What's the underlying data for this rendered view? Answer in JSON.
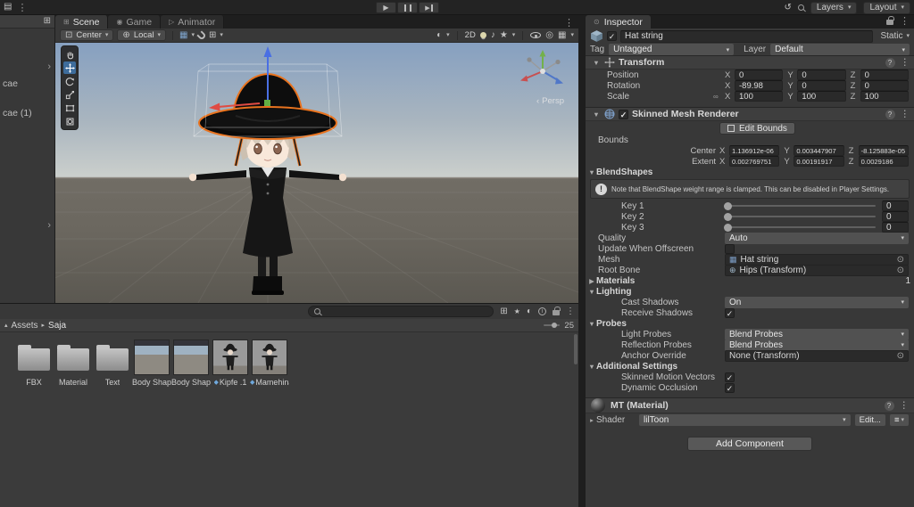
{
  "colors": {
    "selection_orange": "#E8731F",
    "unity_selected_blue": "#3E6D9C"
  },
  "topbar": {
    "tabs": [
      {
        "label": "Scene"
      },
      {
        "label": "Game"
      },
      {
        "label": "Animator"
      }
    ],
    "layers_label": "Layers",
    "layout_label": "Layout"
  },
  "hierarchy": {
    "items": [
      "cae",
      "cae (1)"
    ]
  },
  "scene": {
    "toolbar": {
      "pivot": "Center",
      "orientation": "Local",
      "mode_2d": "2D"
    },
    "persp_label": "Persp"
  },
  "project": {
    "root_label": "Assets",
    "folder_label": "Saja",
    "zoom": "25",
    "items": [
      {
        "label": "FBX",
        "type": "folder"
      },
      {
        "label": "Material",
        "type": "folder"
      },
      {
        "label": "Text",
        "type": "folder"
      },
      {
        "label": "Body Shap...",
        "type": "shot"
      },
      {
        "label": "Body Shap...",
        "type": "shot"
      },
      {
        "label": "Kipfe .1",
        "type": "model"
      },
      {
        "label": "Mamehina...",
        "type": "model"
      }
    ]
  },
  "inspector": {
    "tab_label": "Inspector",
    "header": {
      "name": "Hat string",
      "static_label": "Static",
      "tag_label": "Tag",
      "tag": "Untagged",
      "layer_label": "Layer",
      "layer": "Default"
    },
    "axis": [
      "X",
      "Y",
      "Z"
    ],
    "transform": {
      "title": "Transform",
      "rows": [
        {
          "label": "Position",
          "x": "0",
          "y": "0",
          "z": "0"
        },
        {
          "label": "Rotation",
          "x": "-89.98",
          "y": "0",
          "z": "0"
        },
        {
          "label": "Scale",
          "x": "100",
          "y": "100",
          "z": "100"
        }
      ]
    },
    "smr": {
      "title": "Skinned Mesh Renderer",
      "edit_bounds_label": "Edit Bounds",
      "bounds_label": "Bounds",
      "bounds_rows": [
        {
          "label": "Center",
          "x": "1.136912e-06",
          "y": "0.003447907",
          "z": "-8.125883e-05"
        },
        {
          "label": "Extent",
          "x": "0.002769751",
          "y": "0.00191917",
          "z": "0.0029186"
        }
      ],
      "blendshapes_label": "BlendShapes",
      "note": "Note that BlendShape weight range is clamped. This can be disabled in Player Settings.",
      "keys": [
        {
          "label": "Key 1",
          "value": "0"
        },
        {
          "label": "Key 2",
          "value": "0"
        },
        {
          "label": "Key 3",
          "value": "0"
        }
      ],
      "quality_label": "Quality",
      "quality_value": "Auto",
      "update_offscreen_label": "Update When Offscreen",
      "mesh_label": "Mesh",
      "mesh_value": "Hat string",
      "root_bone_label": "Root Bone",
      "root_bone_value": "Hips (Transform)",
      "materials_label": "Materials",
      "materials_count": "1",
      "lighting_label": "Lighting",
      "cast_shadows_label": "Cast Shadows",
      "cast_shadows_value": "On",
      "receive_shadows_label": "Receive Shadows",
      "probes_label": "Probes",
      "light_probes_label": "Light Probes",
      "light_probes_value": "Blend Probes",
      "reflection_probes_label": "Reflection Probes",
      "reflection_probes_value": "Blend Probes",
      "anchor_override_label": "Anchor Override",
      "anchor_override_value": "None (Transform)",
      "additional_label": "Additional Settings",
      "motion_vectors_label": "Skinned Motion Vectors",
      "dynamic_occlusion_label": "Dynamic Occlusion"
    },
    "material": {
      "title": "MT (Material)",
      "shader_label": "Shader",
      "shader_value": "lilToon",
      "edit_label": "Edit..."
    },
    "add_component_label": "Add Component"
  }
}
